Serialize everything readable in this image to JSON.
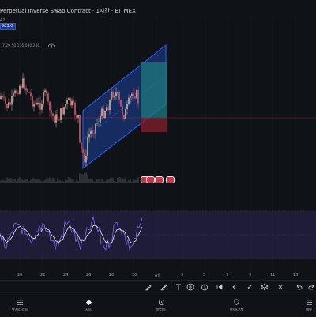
{
  "header": {
    "title": "Perpetual Inverse Swap Contract · 1시간 · BITMEX",
    "price_chip": "983.0",
    "price_chip_sub": "42",
    "volume_readout": "7.29 50 106 030 246"
  },
  "x_axis": {
    "labels": [
      "20",
      "22",
      "24",
      "26",
      "28",
      "30",
      "8월",
      "3",
      "5",
      "7",
      "9",
      "11",
      "13"
    ]
  },
  "toolbar": {
    "icons": [
      "pencil-icon",
      "brush-icon",
      "text-tool-icon",
      "add-icon",
      "alarm-icon",
      "rewind-icon",
      "step-back-icon",
      "ruler-icon",
      "layers-icon",
      "cross-out-icon",
      "trend-line-icon",
      "fibonacci-icon",
      "undo-icon",
      "redo-icon"
    ]
  },
  "bottom_nav": {
    "items": [
      {
        "label": "왓치리스트",
        "icon": "list-icon"
      },
      {
        "label": "차트",
        "icon": "chart-icon"
      },
      {
        "label": "알러트",
        "icon": "alarm-icon"
      },
      {
        "label": "아이디어",
        "icon": "lightbulb-icon"
      },
      {
        "label": "메뉴",
        "icon": "menu-icon"
      }
    ]
  },
  "colors": {
    "background": "#0f1216",
    "channel_fill": "#1d3f9e",
    "channel_line": "#2962ff",
    "target_zone": "#1e7a7e",
    "stop_zone": "#7a1f2b",
    "candle_up": "#c8b7a6",
    "candle_down": "#d05a70",
    "oscillator_fill": "#2a2350",
    "oscillator_line": "#7a6cf0",
    "signal_line": "#e8e8ee"
  }
}
